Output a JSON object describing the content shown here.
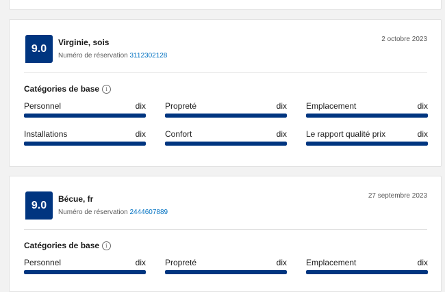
{
  "ui": {
    "category_heading": "Catégories de base",
    "info_icon_glyph": "i",
    "booking_label": "Numéro de réservation"
  },
  "reviews": [
    {
      "score": "9.0",
      "name": "Virginie, sois",
      "booking_number": "3112302128",
      "date": "2 octobre 2023",
      "categories": [
        {
          "label": "Personnel",
          "value": "dix",
          "fraction": 1.0
        },
        {
          "label": "Propreté",
          "value": "dix",
          "fraction": 1.0
        },
        {
          "label": "Emplacement",
          "value": "dix",
          "fraction": 1.0
        },
        {
          "label": "Installations",
          "value": "dix",
          "fraction": 1.0
        },
        {
          "label": "Confort",
          "value": "dix",
          "fraction": 1.0
        },
        {
          "label": "Le rapport qualité prix",
          "value": "dix",
          "fraction": 1.0
        }
      ]
    },
    {
      "score": "9.0",
      "name": "Bécue, fr",
      "booking_number": "2444607889",
      "date": "27 septembre 2023",
      "categories": [
        {
          "label": "Personnel",
          "value": "dix",
          "fraction": 1.0
        },
        {
          "label": "Propreté",
          "value": "dix",
          "fraction": 1.0
        },
        {
          "label": "Emplacement",
          "value": "dix",
          "fraction": 1.0
        }
      ]
    }
  ],
  "colors": {
    "score_badge": "#003580",
    "bar_fill": "#003580",
    "link": "#0071c2"
  }
}
